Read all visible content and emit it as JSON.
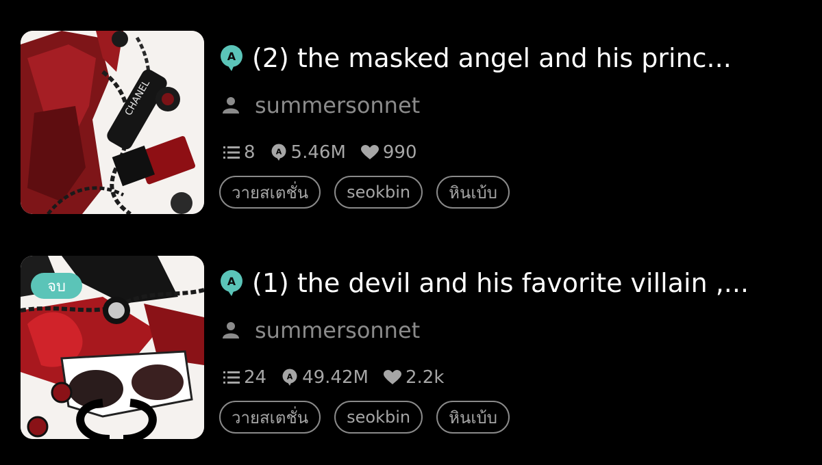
{
  "colors": {
    "background": "#000000",
    "accent": "#5bc4b8",
    "secondary_text": "#8b8b8b"
  },
  "stories": [
    {
      "title": "(2) the masked angel and his princ...",
      "author": "summersonnet",
      "icons": {
        "title": "comic-mark-icon",
        "author": "person-icon"
      },
      "stats": {
        "chapters": "8",
        "views": "5.46M",
        "likes": "990"
      },
      "tags": [
        "วายสเตชั่น",
        "seokbin",
        "หินเบ้บ"
      ],
      "completed_badge": null
    },
    {
      "title": "(1) the devil and his favorite villain ,...",
      "author": "summersonnet",
      "icons": {
        "title": "comic-mark-icon",
        "author": "person-icon"
      },
      "stats": {
        "chapters": "24",
        "views": "49.42M",
        "likes": "2.2k"
      },
      "tags": [
        "วายสเตชั่น",
        "seokbin",
        "หินเบ้บ"
      ],
      "completed_badge": "จบ"
    }
  ]
}
